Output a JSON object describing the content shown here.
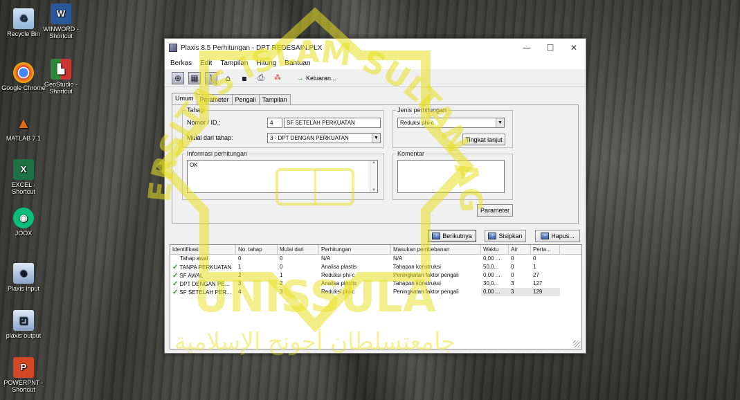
{
  "desktop": {
    "icons": [
      {
        "label": "Recycle Bin",
        "icon": "recycle-bin-icon"
      },
      {
        "label": "WINWORD - Shortcut",
        "icon": "word-icon"
      },
      {
        "label": "Google Chrome",
        "icon": "chrome-icon"
      },
      {
        "label": "GeoStudio - Shortcut",
        "icon": "geostudio-icon"
      },
      {
        "label": "MATLAB 7.1",
        "icon": "matlab-icon"
      },
      {
        "label": "EXCEL - Shortcut",
        "icon": "excel-icon"
      },
      {
        "label": "JOOX",
        "icon": "joox-icon"
      },
      {
        "label": "Plaxis input",
        "icon": "plaxis-input-icon"
      },
      {
        "label": "plaxis output",
        "icon": "plaxis-output-icon"
      },
      {
        "label": "POWERPNT - Shortcut",
        "icon": "powerpoint-icon"
      }
    ]
  },
  "watermark": {
    "top_text": "UNIVERSITAS ISLAM SULTAN AGUNG",
    "center_text": "UNISSULA",
    "arabic_text": "جامعتسلطان أجونج الإسلامية"
  },
  "window": {
    "title": "Plaxis 8.5 Perhitungan - DPT REDESAIN.PLX",
    "minimize": "—",
    "maximize": "☐",
    "close": "✕"
  },
  "menu": [
    "Berkas",
    "Edit",
    "Tampilan",
    "Hitung",
    "Bantuan"
  ],
  "toolbar": {
    "keluaran_label": "Keluaran..."
  },
  "tabs": [
    "Umum",
    "Parameter",
    "Pengali",
    "Tampilan"
  ],
  "tahap": {
    "legend": "Tahap",
    "nomor_label": "Nomor / ID.:",
    "nomor_value": "4",
    "id_value": "SF SETELAH PERKUATAN",
    "mulai_label": "Mulai dari tahap:",
    "mulai_value": "3 - DPT DENGAN PERKUATAN"
  },
  "jenis": {
    "legend": "Jenis perhitungan",
    "value": "Reduksi phi-c",
    "tingkat_button": "Tingkat lanjut"
  },
  "informasi": {
    "legend": "Informasi perhitungan",
    "value": "OK"
  },
  "komentar": {
    "legend": "Komentar",
    "value": ""
  },
  "parameter_button": "Parameter",
  "actions": {
    "berikutnya": "Berikutnya",
    "sisipkan": "Sisipkan",
    "hapus": "Hapus..."
  },
  "table": {
    "headers": [
      "Identifikasi",
      "No. tahap",
      "Mulai dari",
      "Perhitungan",
      "Masukan pembebanan",
      "Waktu",
      "Air",
      "Perta..."
    ],
    "rows": [
      {
        "check": false,
        "id": "Tahap awal",
        "no": "0",
        "mulai": "0",
        "perhitungan": "N/A",
        "masukan": "N/A",
        "waktu": "0,00 ...",
        "air": "0",
        "perta": "0"
      },
      {
        "check": true,
        "id": "TANPA PERKUATAN",
        "no": "1",
        "mulai": "0",
        "perhitungan": "Analisa plastis",
        "masukan": "Tahapan konstruksi",
        "waktu": "50,0...",
        "air": "0",
        "perta": "1"
      },
      {
        "check": true,
        "id": "SF AWAL",
        "no": "2",
        "mulai": "1",
        "perhitungan": "Reduksi phi-c",
        "masukan": "Peningkatan faktor pengali",
        "waktu": "0,00 ...",
        "air": "0",
        "perta": "27"
      },
      {
        "check": true,
        "id": "DPT DENGAN PE...",
        "no": "3",
        "mulai": "2",
        "perhitungan": "Analisa plastis",
        "masukan": "Tahapan konstruksi",
        "waktu": "30,0...",
        "air": "3",
        "perta": "127"
      },
      {
        "check": true,
        "id": "SF SETELAH PER...",
        "no": "4",
        "mulai": "3",
        "perhitungan": "Reduksi phi-c",
        "masukan": "Peningkatan faktor pengali",
        "waktu": "0,00 ...",
        "air": "3",
        "perta": "129"
      }
    ]
  }
}
